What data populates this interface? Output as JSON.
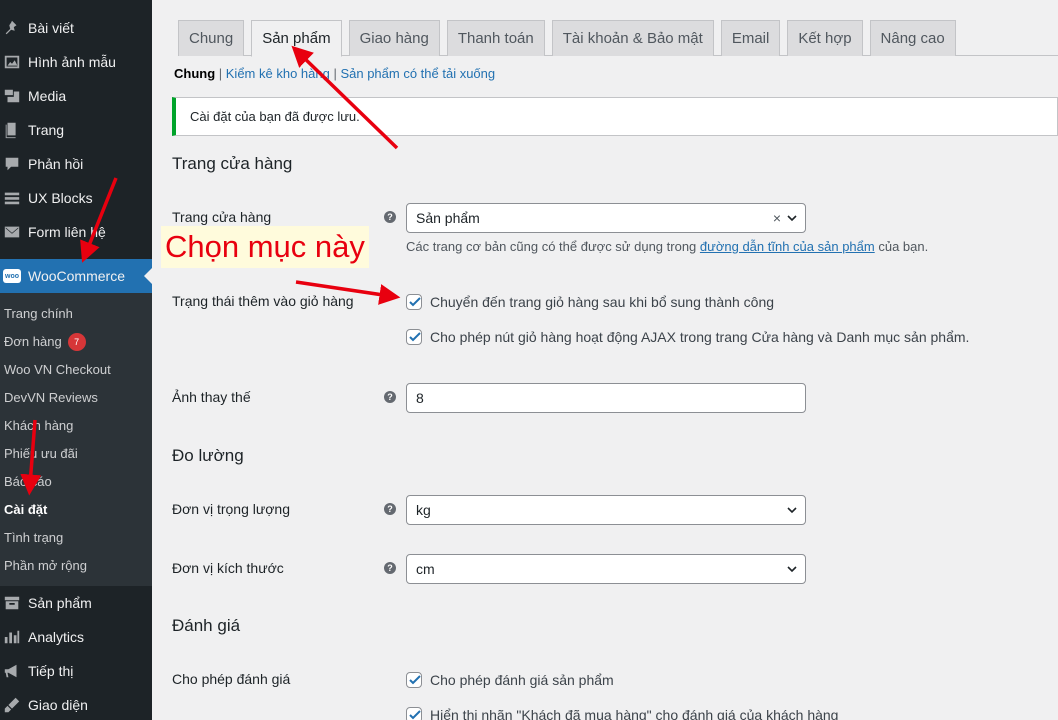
{
  "sidebar": {
    "top_items": [
      {
        "label": "Bài viết",
        "icon": "pin-icon"
      },
      {
        "label": "Hình ảnh mẫu",
        "icon": "image-icon"
      },
      {
        "label": "Media",
        "icon": "media-icon"
      },
      {
        "label": "Trang",
        "icon": "page-icon"
      },
      {
        "label": "Phản hồi",
        "icon": "comment-icon"
      },
      {
        "label": "UX Blocks",
        "icon": "blocks-icon"
      },
      {
        "label": "Form liên hệ",
        "icon": "mail-icon"
      }
    ],
    "woocommerce": {
      "label": "WooCommerce",
      "logo_text": "woo"
    },
    "sub_items": [
      {
        "label": "Trang chính"
      },
      {
        "label": "Đơn hàng",
        "badge": "7"
      },
      {
        "label": "Woo VN Checkout"
      },
      {
        "label": "DevVN Reviews"
      },
      {
        "label": "Khách hàng"
      },
      {
        "label": "Phiếu ưu đãi"
      },
      {
        "label": "Báo cáo"
      },
      {
        "label": "Cài đặt"
      },
      {
        "label": "Tình trạng"
      },
      {
        "label": "Phần mở rộng"
      }
    ],
    "bottom_items": [
      {
        "label": "Sản phẩm",
        "icon": "archive-icon"
      },
      {
        "label": "Analytics",
        "icon": "chart-icon"
      },
      {
        "label": "Tiếp thị",
        "icon": "megaphone-icon"
      },
      {
        "label": "Giao diện",
        "icon": "brush-icon"
      }
    ]
  },
  "tabs": [
    "Chung",
    "Sản phẩm",
    "Giao hàng",
    "Thanh toán",
    "Tài khoản & Bảo mật",
    "Email",
    "Kết hợp",
    "Nâng cao"
  ],
  "active_tab": "Sản phẩm",
  "subnav": {
    "current": "Chung",
    "links": [
      "Kiểm kê kho hàng",
      "Sản phẩm có thể tải xuống"
    ]
  },
  "notice": "Cài đặt của bạn đã được lưu.",
  "sections": {
    "shop": {
      "title": "Trang cửa hàng",
      "shop_page": {
        "label": "Trang cửa hàng",
        "value": "Sản phẩm",
        "clear": "×",
        "desc_before": "Các trang cơ bản cũng có thể được sử dụng trong",
        "desc_link": "đường dẫn tĩnh của sản phẩm",
        "desc_after": "của bạn."
      },
      "cart": {
        "label": "Trạng thái thêm vào giỏ hàng",
        "opt1": "Chuyển đến trang giỏ hàng sau khi bổ sung thành công",
        "opt2": "Cho phép nút giỏ hàng hoạt động AJAX trong trang Cửa hàng và Danh mục sản phẩm."
      },
      "placeholder": {
        "label": "Ảnh thay thế",
        "value": "8"
      }
    },
    "measure": {
      "title": "Đo lường",
      "weight": {
        "label": "Đơn vị trọng lượng",
        "value": "kg"
      },
      "dim": {
        "label": "Đơn vị kích thước",
        "value": "cm"
      }
    },
    "reviews": {
      "title": "Đánh giá",
      "allow": {
        "label": "Cho phép đánh giá",
        "opt1": "Cho phép đánh giá sản phẩm",
        "opt2": "Hiển thị nhãn \"Khách đã mua hàng\" cho đánh giá của khách hàng"
      }
    }
  },
  "annotation": {
    "text": "Chọn mục này",
    "color": "#e8000f"
  },
  "help_glyph": "?",
  "colors": {
    "accent": "#2271b1",
    "sidebar": "#1d2327",
    "notice": "#00a32a",
    "badge": "#d63638"
  }
}
